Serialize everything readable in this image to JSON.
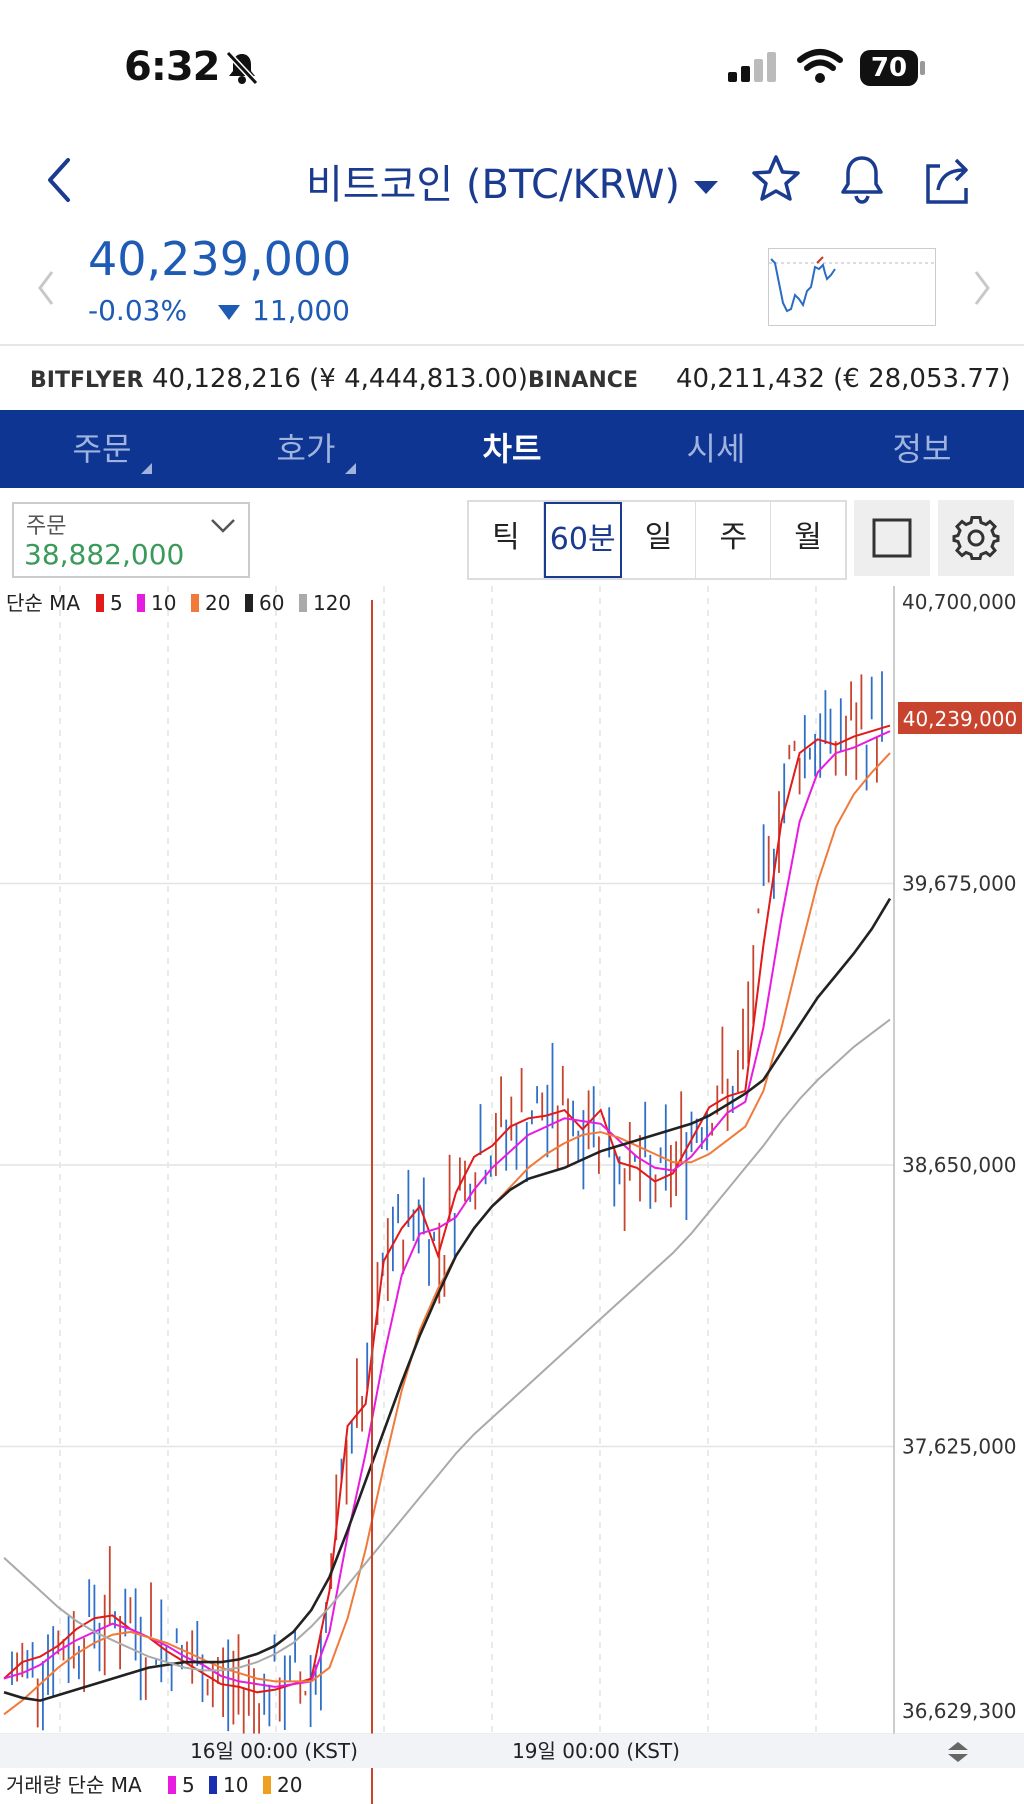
{
  "status_bar": {
    "time": "6:32",
    "battery": "70"
  },
  "header": {
    "title": "비트코인 (BTC/KRW)"
  },
  "price": {
    "current": "40,239,000",
    "change_pct": "-0.03%",
    "change_abs": "11,000"
  },
  "exchanges": [
    {
      "name": "BITFLYER",
      "value": "40,128,216 (¥ 4,444,813.00)"
    },
    {
      "name": "BINANCE",
      "value": "40,211,432 (€ 28,053.77)"
    }
  ],
  "tabs": [
    {
      "label": "주문",
      "has_menu": true
    },
    {
      "label": "호가",
      "has_menu": true
    },
    {
      "label": "차트",
      "active": true
    },
    {
      "label": "시세"
    },
    {
      "label": "정보"
    }
  ],
  "order": {
    "label": "주문",
    "value": "38,882,000"
  },
  "periods": [
    "틱",
    "60분",
    "일",
    "주",
    "월"
  ],
  "active_period": "60분",
  "chart_data": {
    "type": "line",
    "legend": {
      "title": "단순 MA",
      "items": [
        {
          "label": "5",
          "color": "#e21a1a"
        },
        {
          "label": "10",
          "color": "#e81be0"
        },
        {
          "label": "20",
          "color": "#f07a3a"
        },
        {
          "label": "60",
          "color": "#222222"
        },
        {
          "label": "120",
          "color": "#aaaaaa"
        }
      ]
    },
    "y_ticks": [
      "40,700,000",
      "39,675,000",
      "38,650,000",
      "37,625,000",
      "36,629,300"
    ],
    "ylim": [
      36629300,
      40700000
    ],
    "current_price_label": "40,239,000",
    "x_ticks": [
      "16일 00:00 (KST)",
      "19일 00:00 (KST)"
    ],
    "volume_legend": {
      "title": "거래량 단순 MA",
      "items": [
        {
          "label": "5",
          "color": "#e81be0"
        },
        {
          "label": "10",
          "color": "#1a2fb0"
        },
        {
          "label": "20",
          "color": "#f0a020"
        }
      ]
    },
    "series": [
      {
        "name": "5",
        "color": "#e21a1a",
        "values": [
          36780000,
          36840000,
          36860000,
          36900000,
          36960000,
          37000000,
          37010000,
          36960000,
          36930000,
          36880000,
          36840000,
          36800000,
          36760000,
          36750000,
          36730000,
          36740000,
          36760000,
          36780000,
          37100000,
          37700000,
          37780000,
          38300000,
          38420000,
          38500000,
          38320000,
          38550000,
          38680000,
          38720000,
          38790000,
          38820000,
          38830000,
          38850000,
          38780000,
          38850000,
          38660000,
          38640000,
          38590000,
          38620000,
          38740000,
          38860000,
          38900000,
          38920000,
          39450000,
          39900000,
          40150000,
          40200000,
          40180000,
          40210000,
          40230000,
          40250000
        ]
      },
      {
        "name": "10",
        "color": "#e81be0",
        "values": [
          36780000,
          36800000,
          36830000,
          36880000,
          36920000,
          36950000,
          36980000,
          36960000,
          36930000,
          36900000,
          36860000,
          36830000,
          36790000,
          36770000,
          36760000,
          36750000,
          36760000,
          36770000,
          36950000,
          37300000,
          37600000,
          37950000,
          38250000,
          38400000,
          38420000,
          38460000,
          38560000,
          38640000,
          38700000,
          38760000,
          38790000,
          38820000,
          38810000,
          38800000,
          38740000,
          38680000,
          38640000,
          38630000,
          38680000,
          38760000,
          38840000,
          38880000,
          39150000,
          39550000,
          39900000,
          40080000,
          40150000,
          40170000,
          40200000,
          40230000
        ]
      },
      {
        "name": "20",
        "color": "#f07a3a",
        "values": [
          36650000,
          36700000,
          36760000,
          36820000,
          36870000,
          36910000,
          36940000,
          36950000,
          36930000,
          36910000,
          36880000,
          36850000,
          36820000,
          36800000,
          36780000,
          36770000,
          36770000,
          36770000,
          36820000,
          37000000,
          37250000,
          37550000,
          37830000,
          38050000,
          38200000,
          38320000,
          38420000,
          38500000,
          38570000,
          38640000,
          38690000,
          38730000,
          38760000,
          38770000,
          38750000,
          38720000,
          38690000,
          38660000,
          38660000,
          38690000,
          38740000,
          38790000,
          38920000,
          39150000,
          39420000,
          39680000,
          39880000,
          40000000,
          40080000,
          40150000
        ]
      },
      {
        "name": "60",
        "color": "#222222",
        "values": [
          36730000,
          36710000,
          36700000,
          36720000,
          36740000,
          36760000,
          36780000,
          36800000,
          36820000,
          36830000,
          36840000,
          36840000,
          36840000,
          36850000,
          36870000,
          36900000,
          36950000,
          37030000,
          37150000,
          37320000,
          37500000,
          37680000,
          37860000,
          38030000,
          38180000,
          38320000,
          38420000,
          38500000,
          38560000,
          38600000,
          38620000,
          38640000,
          38670000,
          38700000,
          38720000,
          38740000,
          38760000,
          38780000,
          38800000,
          38830000,
          38870000,
          38910000,
          38960000,
          39060000,
          39160000,
          39260000,
          39340000,
          39420000,
          39510000,
          39620000
        ]
      },
      {
        "name": "120",
        "color": "#aaaaaa",
        "values": [
          37220000,
          37160000,
          37100000,
          37040000,
          36990000,
          36950000,
          36920000,
          36890000,
          36860000,
          36840000,
          36820000,
          36810000,
          36810000,
          36820000,
          36840000,
          36870000,
          36910000,
          36970000,
          37040000,
          37120000,
          37200000,
          37280000,
          37360000,
          37440000,
          37520000,
          37600000,
          37670000,
          37730000,
          37790000,
          37850000,
          37910000,
          37970000,
          38030000,
          38090000,
          38150000,
          38210000,
          38270000,
          38330000,
          38400000,
          38480000,
          38560000,
          38640000,
          38720000,
          38810000,
          38890000,
          38960000,
          39020000,
          39080000,
          39130000,
          39180000
        ]
      }
    ]
  }
}
